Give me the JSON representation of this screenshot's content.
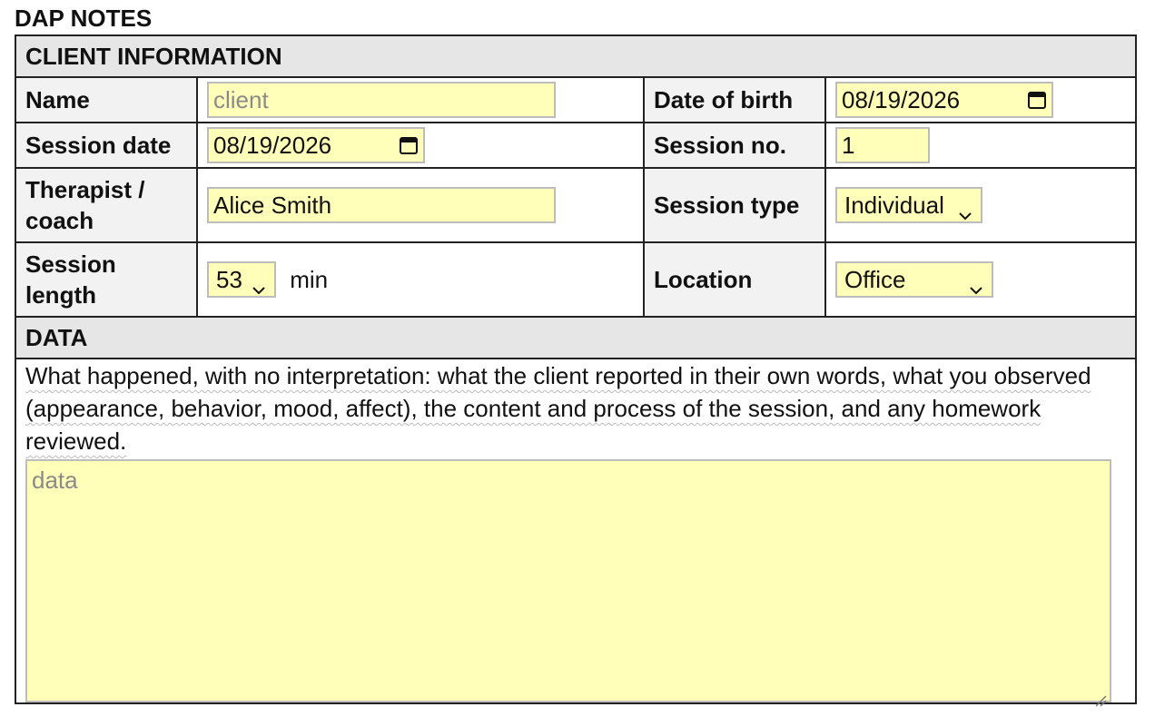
{
  "page": {
    "title": "DAP NOTES"
  },
  "client_info": {
    "section_title": "CLIENT INFORMATION",
    "name": {
      "label": "Name",
      "placeholder": "client"
    },
    "dob": {
      "label": "Date of birth",
      "value": "08/19/2026"
    },
    "session_date": {
      "label": "Session date",
      "value": "08/19/2026"
    },
    "session_no": {
      "label": "Session no.",
      "value": "1"
    },
    "therapist": {
      "label": "Therapist / coach",
      "value": "Alice Smith"
    },
    "session_type": {
      "label": "Session type",
      "value": "Individual"
    },
    "session_length": {
      "label": "Session length",
      "value": "53",
      "unit": "min"
    },
    "location": {
      "label": "Location",
      "value": "Office"
    }
  },
  "data_section": {
    "section_title": "DATA",
    "description": "What happened, with no interpretation: what the client reported in their own words, what you observed (appearance, behavior, mood, affect), the content and process of the session, and any homework reviewed.",
    "placeholder": "data"
  },
  "colors": {
    "field_bg": "#ffffb9",
    "section_bg": "#e6e6e6",
    "label_bg": "#f2f2f2"
  },
  "icons": {
    "date": "calendar-icon",
    "select": "chevron-down-icon",
    "resize": "resize-grip-icon"
  }
}
